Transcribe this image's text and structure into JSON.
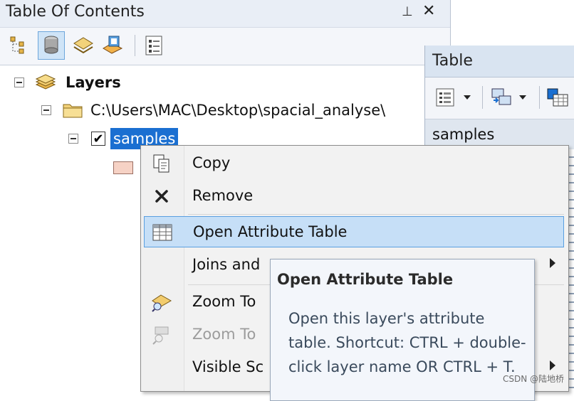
{
  "toc": {
    "title": "Table Of Contents",
    "pin_glyph": "⊥",
    "close_glyph": "✕",
    "tree": {
      "root_label": "Layers",
      "path_label": "C:\\Users\\MAC\\Desktop\\spacial_analyse\\",
      "layer_label": "samples",
      "checkbox_glyph": "✔"
    }
  },
  "table_window": {
    "title": "Table",
    "tab_label": "samples"
  },
  "menu": {
    "items": [
      {
        "label": "Copy"
      },
      {
        "label": "Remove"
      },
      {
        "label": "Open Attribute Table"
      },
      {
        "label": "Joins and"
      },
      {
        "label": "Zoom To"
      },
      {
        "label": "Zoom To"
      },
      {
        "label": "Visible Sc"
      }
    ]
  },
  "tooltip": {
    "title": "Open Attribute Table",
    "body": "Open this layer's attribute table. Shortcut: CTRL + double-click layer name OR CTRL + T."
  },
  "watermark": "CSDN @陆地桥",
  "colors": {
    "selection": "#1a6fd1",
    "menu_highlight": "#c6dff7",
    "swatch": "#f6d2c5"
  }
}
